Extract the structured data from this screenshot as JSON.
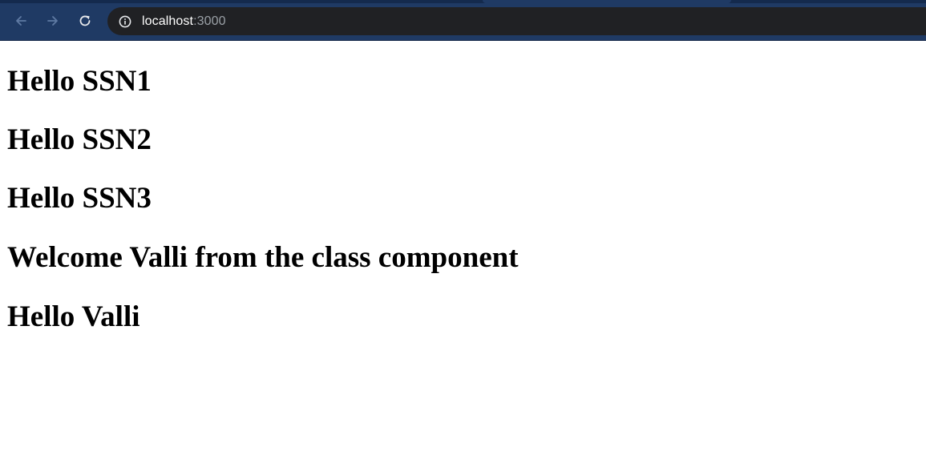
{
  "browser": {
    "url_host": "localhost",
    "url_port": ":3000",
    "icons": {
      "back": "back-arrow-icon",
      "forward": "forward-arrow-icon",
      "reload": "reload-icon",
      "site_info": "info-icon"
    },
    "colors": {
      "chrome_bg": "#1f3a64",
      "omnibox_bg": "#202124"
    }
  },
  "page": {
    "headings": [
      "Hello SSN1",
      "Hello SSN2",
      "Hello SSN3",
      "Welcome Valli from the class component",
      "Hello Valli"
    ]
  }
}
